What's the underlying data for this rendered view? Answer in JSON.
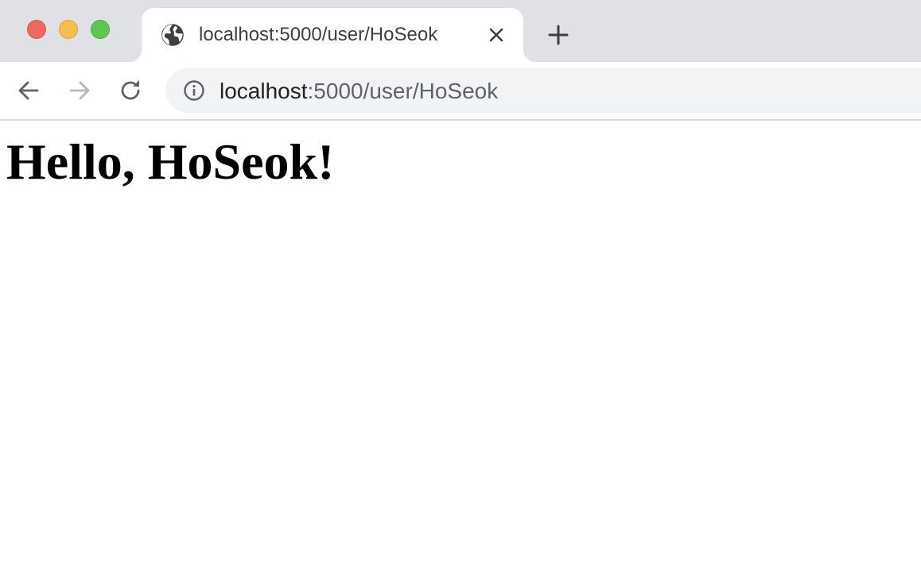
{
  "window": {
    "traffic_lights": {
      "close_color": "#ed6a5e",
      "minimize_color": "#f5bf4f",
      "zoom_color": "#61c554"
    }
  },
  "tab": {
    "title": "localhost:5000/user/HoSeok",
    "favicon": "globe-icon",
    "close_icon": "close-icon"
  },
  "toolbar": {
    "back_icon": "arrow-left-icon",
    "forward_icon": "arrow-right-icon",
    "reload_icon": "reload-icon",
    "site_info_icon": "info-icon",
    "new_tab_icon": "plus-icon"
  },
  "omnibox": {
    "host": "localhost",
    "rest": ":5000/user/HoSeok"
  },
  "page": {
    "heading": "Hello, HoSeok!"
  }
}
